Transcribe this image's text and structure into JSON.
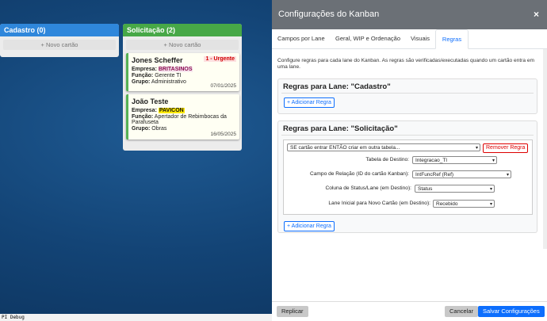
{
  "lanes": [
    {
      "title": "Cadastro (0)",
      "color": "#2f87db",
      "add_label": "+ Novo cartão"
    },
    {
      "title": "Solicitação (2)",
      "color": "#47a847",
      "add_label": "+ Novo cartão"
    }
  ],
  "cards": [
    {
      "name": "Jones Scheffer",
      "priority": "1 - Urgente",
      "empresa_label": "Empresa:",
      "empresa": "BRITASINOS",
      "funcao_label": "Função:",
      "funcao": "Gerente TI",
      "grupo_label": "Grupo:",
      "grupo": "Administrativo",
      "date": "07/01/2025"
    },
    {
      "name": "João Teste",
      "empresa_label": "Empresa:",
      "empresa": "PAVICON",
      "funcao_label": "Função:",
      "funcao": "Apertador de Rebimbocas da Parafuseta",
      "grupo_label": "Grupo:",
      "grupo": "Obras",
      "date": "16/05/2025"
    }
  ],
  "debug_label": "PI Debug",
  "panel": {
    "title": "Configurações do Kanban",
    "close": "×",
    "tabs": [
      "Campos por Lane",
      "Geral, WIP e Ordenação",
      "Visuais",
      "Regras"
    ],
    "active_tab": "Regras",
    "intro": "Configure regras para cada lane do Kanban. As regras são verificadas/executadas quando um cartão entra em uma lane.",
    "rules": [
      {
        "title": "Regras para Lane: \"Cadastro\"",
        "add_label": "+ Adicionar Regra"
      },
      {
        "title": "Regras para Lane: \"Solicitação\"",
        "add_label": "+ Adicionar Regra",
        "rule_type": "SE cartão entrar ENTÃO criar em outra tabela...",
        "remove_label": "Remover Regra",
        "fields": [
          {
            "label": "Tabela de Destino:",
            "value": "Integracao_TI"
          },
          {
            "label": "Campo de Relação (ID do cartão Kanban):",
            "value": "IntFuncRef (Ref)"
          },
          {
            "label": "Coluna de Status/Lane (em Destino):",
            "value": "Status"
          },
          {
            "label": "Lane Inicial para Novo Cartão (em Destino):",
            "value": "Recebido"
          }
        ]
      }
    ],
    "footer": {
      "replicar": "Replicar",
      "cancel": "Cancelar",
      "save": "Salvar Configurações"
    }
  }
}
